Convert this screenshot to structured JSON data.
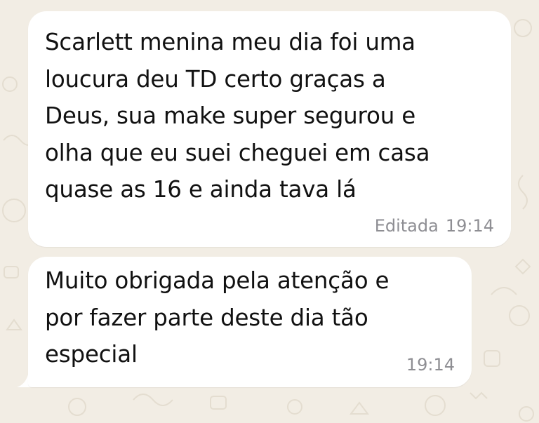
{
  "chat": {
    "wallpaper_color": "#f2ede4",
    "bubble_color": "#ffffff",
    "messages": [
      {
        "text": "Scarlett menina meu dia foi uma\nloucura deu TD certo graças a\nDeus, sua make super segurou e\nolha que eu suei cheguei em casa\nquase as 16 e ainda tava lá",
        "edited_label": "Editada",
        "time": "19:14"
      },
      {
        "text": "Muito obrigada pela atenção e\npor fazer parte deste dia tão\nespecial",
        "time": "19:14"
      }
    ]
  }
}
